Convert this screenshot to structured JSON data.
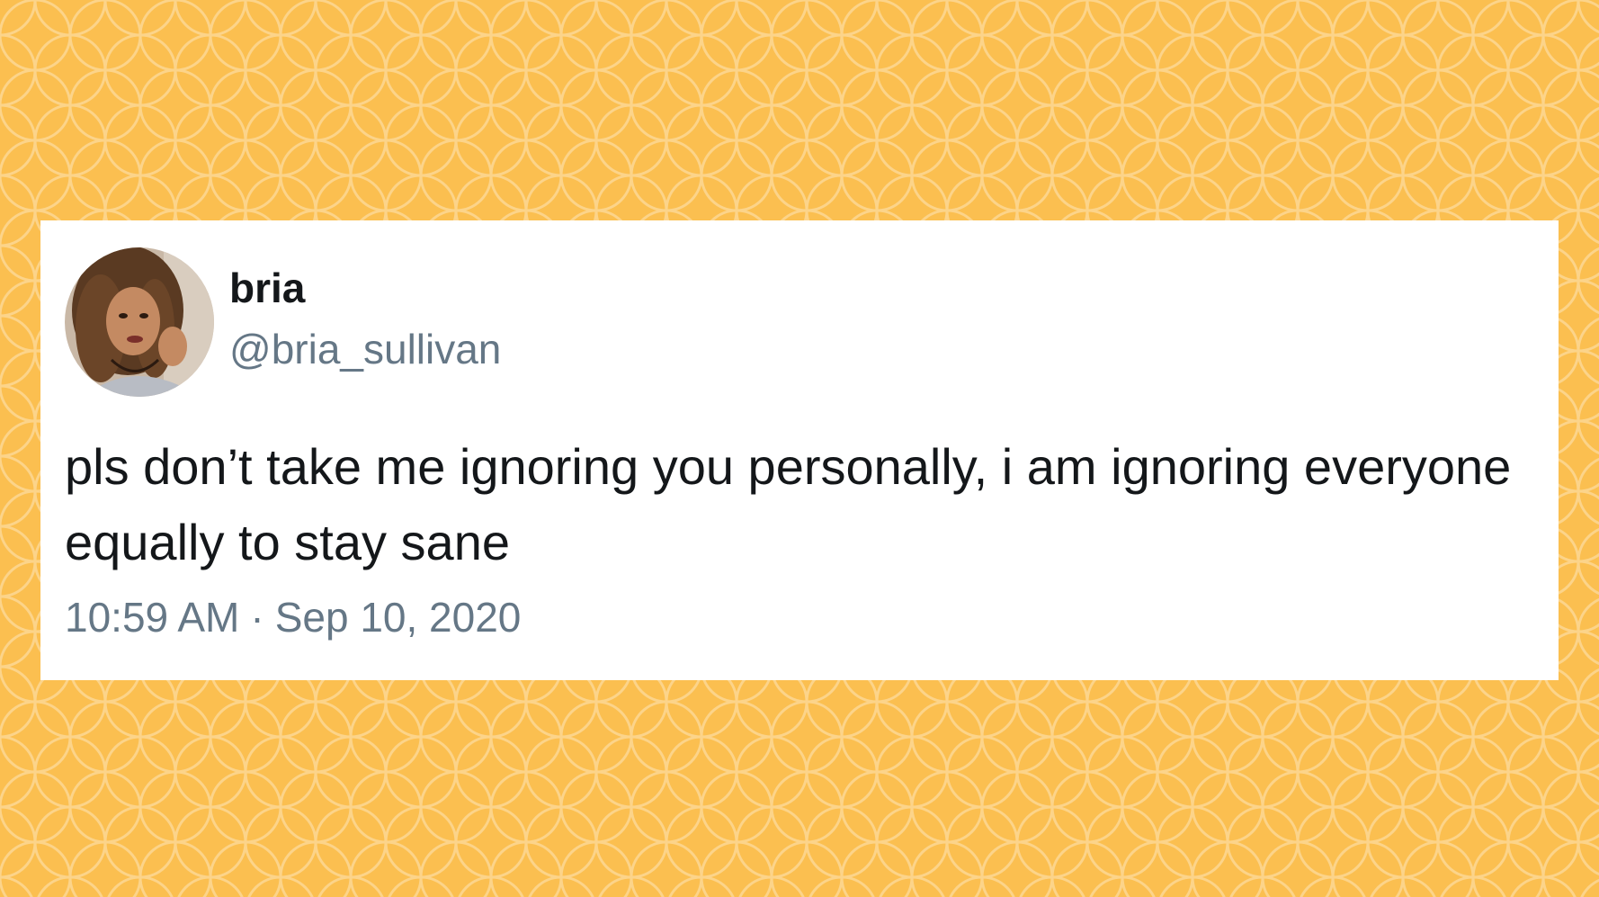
{
  "background": {
    "color": "#fbbf50",
    "pattern_color": "#fcd48a"
  },
  "tweet": {
    "display_name": "bria",
    "handle": "@bria_sullivan",
    "text": "pls don’t take me ignoring you personally, i am ignoring everyone equally to stay sane",
    "time": "10:59 AM",
    "separator": "·",
    "date": "Sep 10, 2020",
    "avatar_icon": "profile-photo"
  }
}
